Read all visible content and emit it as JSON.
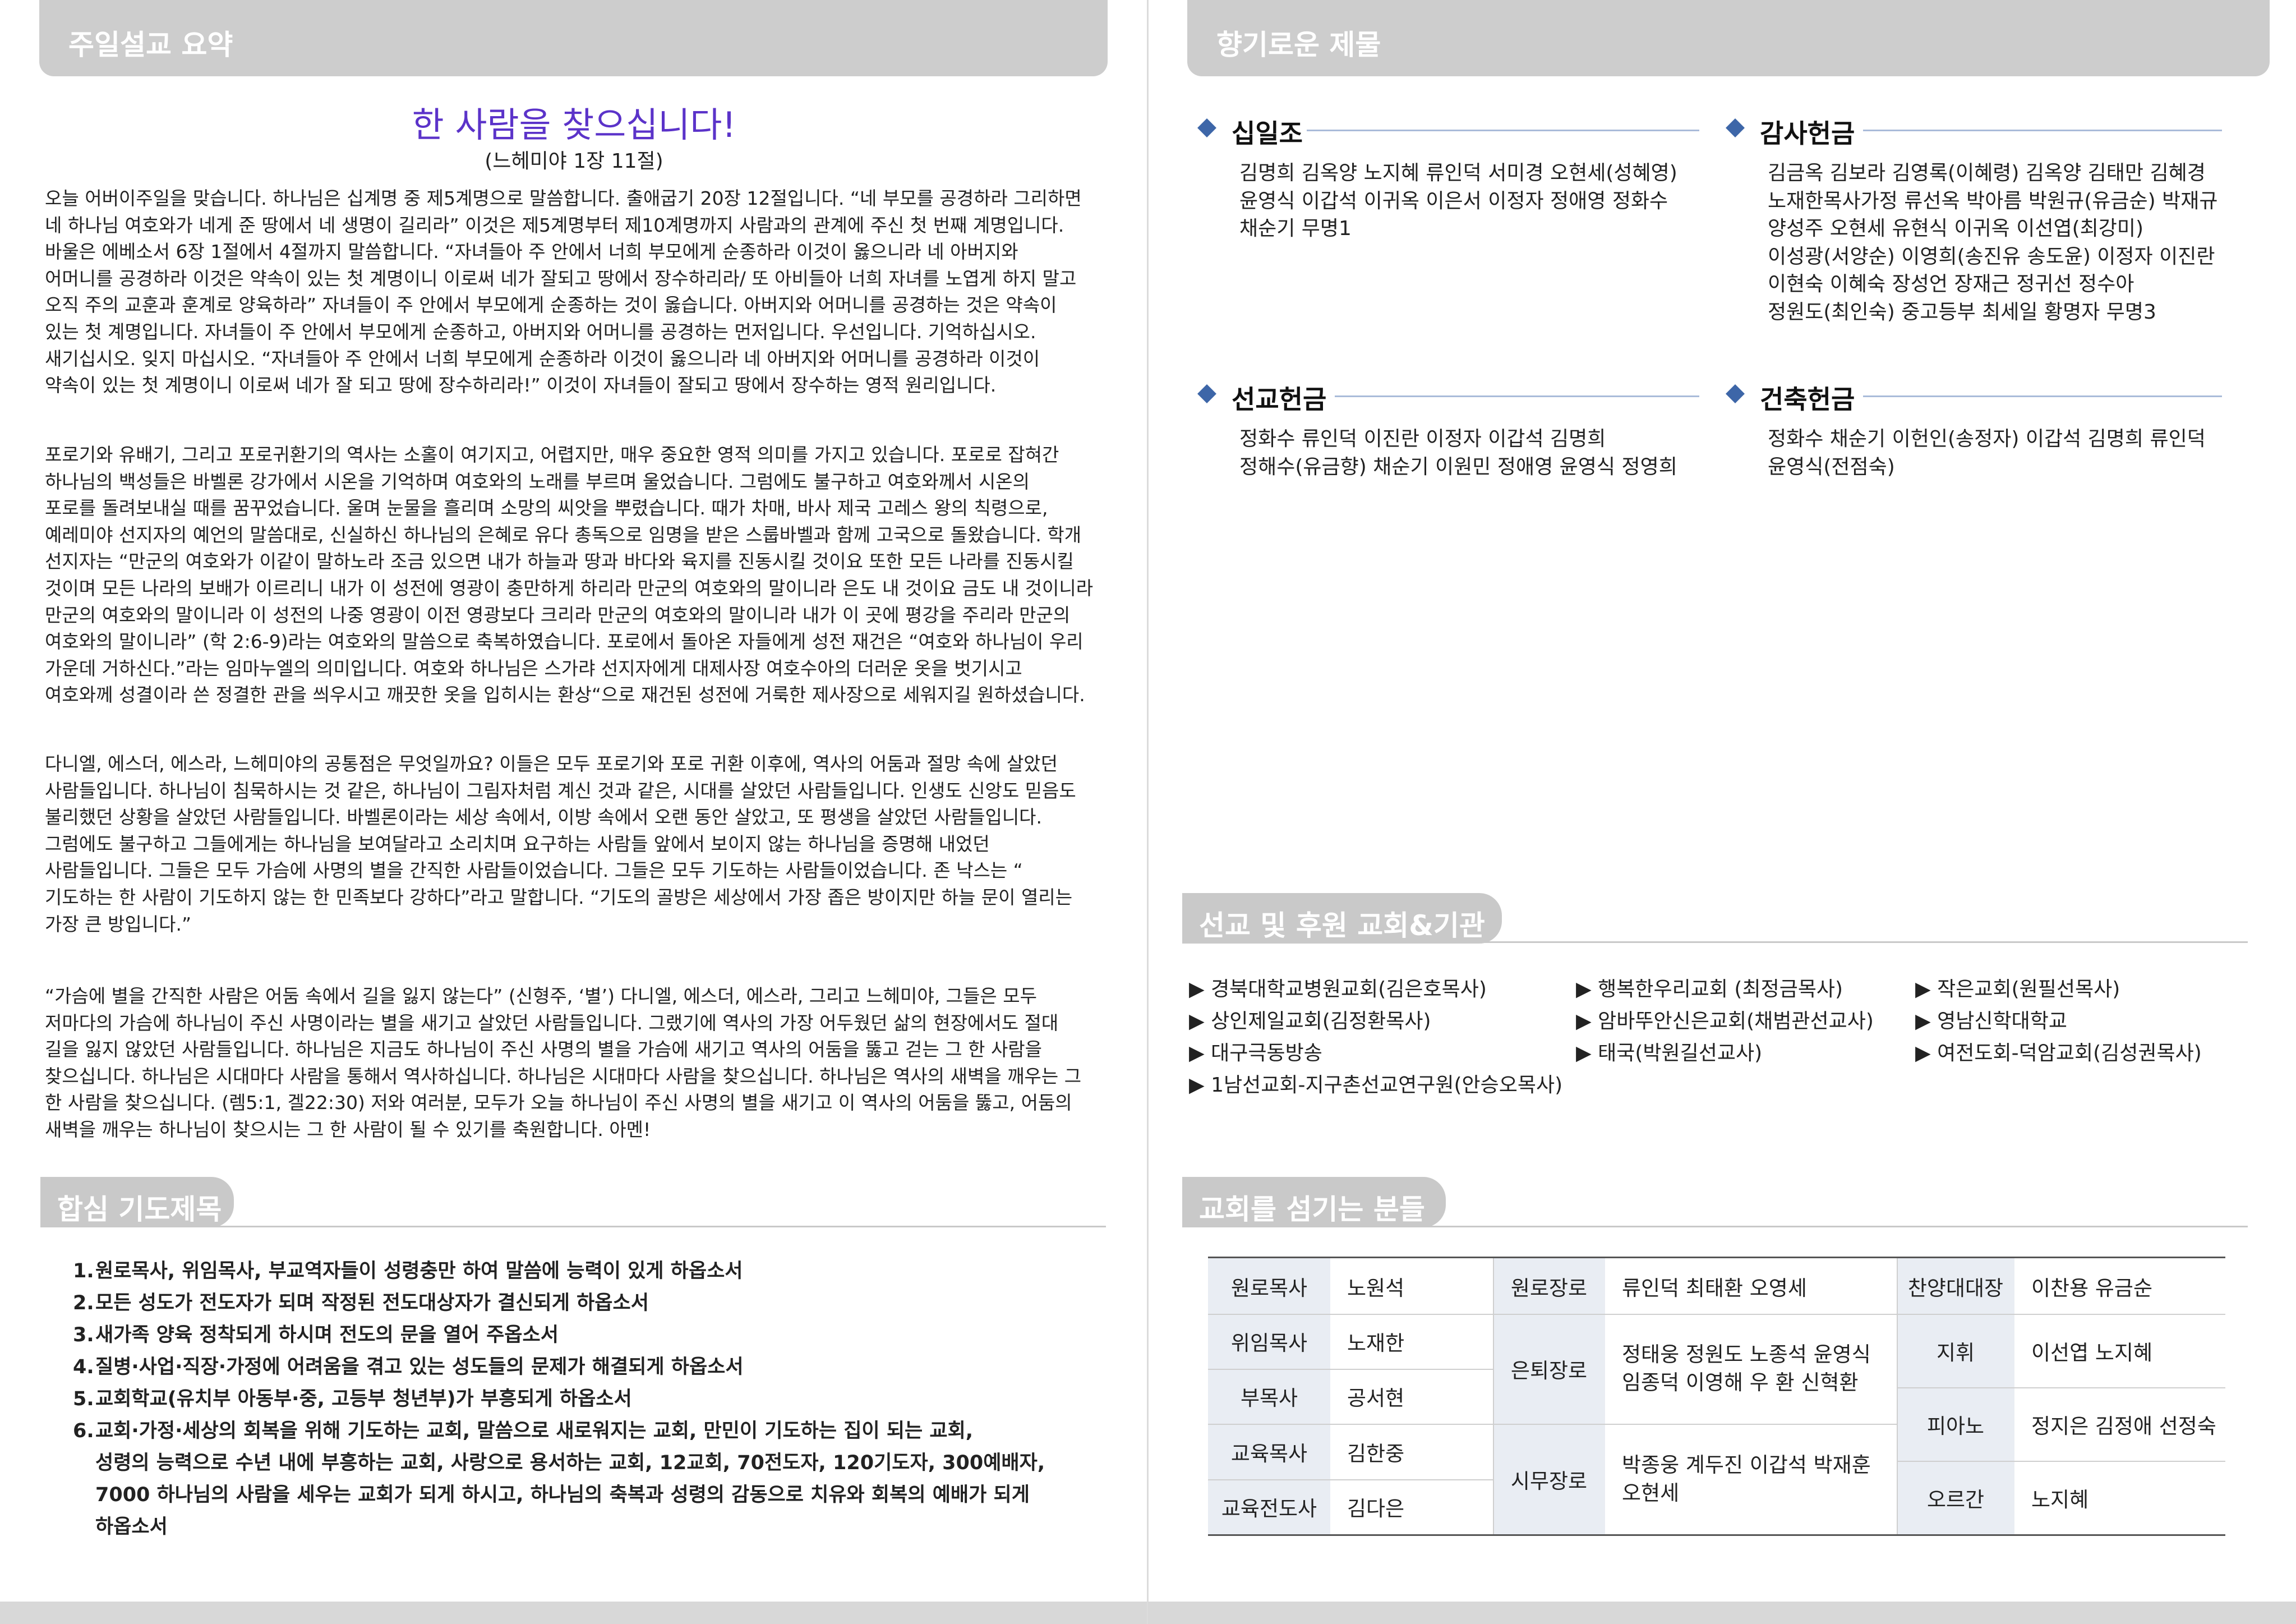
{
  "left": {
    "header": "주일설교 요약",
    "sermon": {
      "title": "한 사람을 찾으십니다!",
      "reference": "(느헤미야 1장 11절)",
      "paragraphs": [
        "오늘 어버이주일을 맞습니다. 하나님은 십계명 중 제5계명으로 말씀합니다. 출애굽기 20장 12절입니다. “네 부모를 공경하라 그리하면\n네 하나님 여호와가 네게 준 땅에서 네 생명이 길리라” 이것은 제5계명부터 제10계명까지 사람과의 관계에 주신 첫 번째 계명입니다.\n바울은 에베소서 6장 1절에서 4절까지 말씀합니다. “자녀들아 주 안에서 너희 부모에게 순종하라 이것이 옳으니라 네 아버지와\n어머니를 공경하라 이것은 약속이 있는 첫 계명이니 이로써 네가 잘되고 땅에서 장수하리라/ 또 아비들아 너희 자녀를 노엽게 하지 말고\n오직 주의 교훈과 훈계로 양육하라” 자녀들이 주 안에서 부모에게 순종하는 것이 옳습니다. 아버지와 어머니를 공경하는 것은 약속이\n있는 첫 계명입니다. 자녀들이 주 안에서 부모에게 순종하고, 아버지와 어머니를 공경하는 먼저입니다. 우선입니다. 기억하십시오.\n새기십시오. 잊지 마십시오. “자녀들아 주 안에서 너희 부모에게 순종하라 이것이 옳으니라 네 아버지와 어머니를 공경하라 이것이\n약속이 있는 첫 계명이니 이로써 네가 잘 되고 땅에 장수하리라!” 이것이 자녀들이 잘되고 땅에서 장수하는 영적 원리입니다.",
        "포로기와 유배기, 그리고 포로귀환기의 역사는 소홀이 여기지고, 어렵지만, 매우 중요한 영적 의미를 가지고 있습니다. 포로로 잡혀간\n하나님의 백성들은 바벨론 강가에서 시온을 기억하며 여호와의 노래를 부르며 울었습니다. 그럼에도 불구하고 여호와께서 시온의\n포로를 돌려보내실 때를 꿈꾸었습니다. 울며 눈물을 흘리며 소망의 씨앗을 뿌렸습니다. 때가 차매, 바사 제국 고레스 왕의 칙령으로,\n예레미야 선지자의 예언의 말씀대로, 신실하신 하나님의 은혜로 유다 총독으로 임명을 받은 스룹바벨과 함께 고국으로 돌왔습니다. 학개\n선지자는 “만군의 여호와가 이같이 말하노라 조금 있으면 내가 하늘과 땅과 바다와 육지를 진동시킬 것이요 또한 모든 나라를 진동시킬\n것이며 모든 나라의 보배가 이르리니 내가 이 성전에 영광이 충만하게 하리라 만군의 여호와의 말이니라 은도 내 것이요 금도 내 것이니라\n만군의 여호와의 말이니라 이 성전의 나중 영광이 이전 영광보다 크리라 만군의 여호와의 말이니라 내가 이 곳에 평강을 주리라 만군의\n여호와의 말이니라” (학 2:6-9)라는 여호와의 말씀으로 축복하였습니다. 포로에서 돌아온 자들에게 성전 재건은 “여호와 하나님이 우리\n가운데 거하신다.”라는 임마누엘의 의미입니다. 여호와 하나님은 스가랴 선지자에게 대제사장 여호수아의 더러운 옷을 벗기시고\n여호와께 성결이라 쓴 정결한 관을 씌우시고 깨끗한 옷을 입히시는 환상“으로 재건된 성전에 거룩한 제사장으로 세워지길 원하셨습니다.",
        "다니엘, 에스더, 에스라, 느헤미야의 공통점은 무엇일까요? 이들은 모두 포로기와 포로 귀환 이후에, 역사의 어둠과 절망 속에 살았던\n사람들입니다. 하나님이 침묵하시는 것 같은, 하나님이 그림자처럼 계신 것과 같은, 시대를 살았던 사람들입니다. 인생도 신앙도 믿음도\n불리했던 상황을 살았던 사람들입니다. 바벨론이라는 세상 속에서, 이방 속에서 오랜 동안 살았고, 또 평생을 살았던 사람들입니다.\n그럼에도 불구하고 그들에게는 하나님을 보여달라고 소리치며 요구하는 사람들 앞에서 보이지 않는 하나님을 증명해 내었던\n사람들입니다. 그들은 모두 가슴에 사명의 별을 간직한 사람들이었습니다. 그들은 모두 기도하는 사람들이었습니다. 존 낙스는 “\n기도하는 한 사람이 기도하지 않는 한 민족보다 강하다”라고 말합니다. “기도의 골방은 세상에서 가장 좁은 방이지만 하늘 문이 열리는\n가장 큰 방입니다.”",
        "“가슴에 별을 간직한 사람은 어둠 속에서 길을 잃지 않는다” (신형주, ‘별’) 다니엘, 에스더, 에스라, 그리고 느헤미야, 그들은 모두\n저마다의 가슴에 하나님이 주신 사명이라는 별을 새기고 살았던 사람들입니다. 그랬기에 역사의 가장 어두웠던 삶의 현장에서도 절대\n길을 잃지 않았던 사람들입니다. 하나님은 지금도 하나님이 주신 사명의 별을 가슴에 새기고 역사의 어둠을 뚫고 걷는 그 한 사람을\n찾으십니다. 하나님은 시대마다 사람을 통해서 역사하십니다. 하나님은 시대마다 사람을 찾으십니다. 하나님은 역사의 새벽을 깨우는 그\n한 사람을 찾으십니다. (렘5:1, 겔22:30) 저와 여러분, 모두가 오늘 하나님이 주신 사명의 별을 새기고 이 역사의 어둠을 뚫고, 어둠의\n새벽을 깨우는 하나님이 찾으시는 그 한 사람이 될 수 있기를 축원합니다. 아멘!"
      ]
    },
    "prayer": {
      "header": "합심 기도제목",
      "items": [
        {
          "num": "1.",
          "text": "원로목사, 위임목사, 부교역자들이 성령충만 하여 말씀에 능력이 있게 하옵소서"
        },
        {
          "num": "2.",
          "text": "모든 성도가 전도자가 되며 작정된 전도대상자가 결신되게 하옵소서"
        },
        {
          "num": "3.",
          "text": "새가족 양육 정착되게 하시며 전도의 문을 열어 주옵소서"
        },
        {
          "num": "4.",
          "text": "질병·사업·직장·가정에 어려움을 겪고 있는 성도들의 문제가 해결되게 하옵소서"
        },
        {
          "num": "5.",
          "text": "교회학교(유치부 아동부·중, 고등부 청년부)가 부흥되게 하옵소서"
        },
        {
          "num": "6.",
          "text": "교회·가정·세상의 회복을 위해 기도하는 교회, 말씀으로 새로워지는 교회, 만민이 기도하는 집이 되는 교회,"
        },
        {
          "num": "",
          "text": "성령의 능력으로 수년 내에 부흥하는 교회, 사랑으로 용서하는 교회, 12교회, 70전도자, 120기도자, 300예배자,"
        },
        {
          "num": "",
          "text": "7000 하나님의 사람을 세우는 교회가 되게 하시고, 하나님의 축복과 성령의 감동으로 치유와 회복의 예배가 되게"
        },
        {
          "num": "",
          "text": "하옵소서"
        }
      ]
    }
  },
  "right": {
    "header": "향기로운 제물",
    "offerings": [
      {
        "label": "십일조",
        "names": "김명희 김옥양 노지혜 류인덕 서미경 오현세(성혜영)\n윤영식 이갑석 이귀옥 이은서 이정자 정애영 정화수\n채순기 무명1"
      },
      {
        "label": "감사헌금",
        "names": "김금옥 김보라 김영록(이혜령) 김옥양 김태만 김혜경\n노재한목사가정 류선옥 박아름 박원규(유금순) 박재규\n양성주 오현세 유현식 이귀옥 이선엽(최강미)\n이성광(서양순) 이영희(송진유 송도윤) 이정자 이진란\n이현숙 이혜숙 장성언 장재근 정귀선 정수아\n정원도(최인숙) 중고등부 최세일 황명자 무명3"
      },
      {
        "label": "선교헌금",
        "names": "정화수 류인덕 이진란 이정자 이갑석 김명희\n정해수(유금향) 채순기 이원민 정애영 윤영식 정영희"
      },
      {
        "label": "건축헌금",
        "names": "정화수 채순기 이헌인(송정자) 이갑석 김명희 류인덕\n윤영식(전점숙)"
      }
    ],
    "missions": {
      "header": "선교 및 후원 교회&기관",
      "items": [
        "▶ 경북대학교병원교회(김은호목사)",
        "▶ 행복한우리교회 (최정금목사)",
        "▶ 작은교회(원필선목사)",
        "▶ 상인제일교회(김정환목사)",
        "▶ 암바뚜안신은교회(채범관선교사)",
        "▶ 영남신학대학교",
        "▶ 대구극동방송",
        "▶ 태국(박원길선교사)",
        "▶ 여전도회-덕암교회(김성권목사)",
        "▶ 1남선교회-지구촌선교연구원(안승오목사)"
      ]
    },
    "staff": {
      "header": "교회를 섬기는 분들",
      "col1": [
        {
          "role": "원로목사",
          "name": "노원석"
        },
        {
          "role": "위임목사",
          "name": "노재한"
        },
        {
          "role": "부목사",
          "name": "공서현"
        },
        {
          "role": "교육목사",
          "name": "김한중"
        },
        {
          "role": "교육전도사",
          "name": "김다은"
        }
      ],
      "col2": [
        {
          "role": "원로장로",
          "names": "류인덕 최태환 오영세"
        },
        {
          "role": "은퇴장로",
          "names": "정태웅 정원도 노종석 윤영식\n임종덕 이영해 우  환 신혁환"
        },
        {
          "role": "시무장로",
          "names": "박종웅 계두진 이갑석 박재훈\n오현세"
        }
      ],
      "col3": [
        {
          "role": "찬양대대장",
          "names": "이찬용 유금순"
        },
        {
          "role": "지휘",
          "names": "이선엽 노지혜"
        },
        {
          "role": "피아노",
          "names": "정지은 김정애 선정숙"
        },
        {
          "role": "오르간",
          "names": "노지혜"
        }
      ]
    }
  }
}
